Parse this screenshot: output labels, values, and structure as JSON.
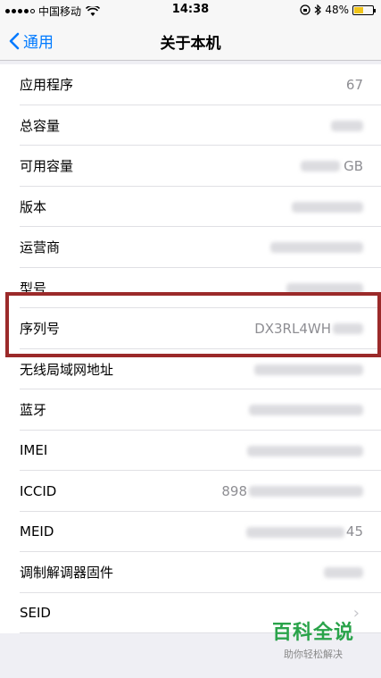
{
  "status_bar": {
    "carrier": "中国移动",
    "time": "14:38",
    "battery_percent": "48%",
    "battery_level": 0.48
  },
  "nav": {
    "back_label": "通用",
    "title": "关于本机"
  },
  "rows": [
    {
      "label": "应用程序",
      "value": "67"
    },
    {
      "label": "总容量",
      "value": ""
    },
    {
      "label": "可用容量",
      "value": "GB"
    },
    {
      "label": "版本",
      "value": ""
    },
    {
      "label": "运营商",
      "value": ""
    },
    {
      "label": "型号",
      "value": ""
    },
    {
      "label": "序列号",
      "value": "DX3RL4WH"
    },
    {
      "label": "无线局域网地址",
      "value": ""
    },
    {
      "label": "蓝牙",
      "value": ""
    },
    {
      "label": "IMEI",
      "value": ""
    },
    {
      "label": "ICCID",
      "value": "898"
    },
    {
      "label": "MEID",
      "value": "45"
    },
    {
      "label": "调制解调器固件",
      "value": ""
    },
    {
      "label": "SEID",
      "value": ""
    }
  ],
  "watermark": {
    "title": "百科全说",
    "subtitle": "助你轻松解决"
  },
  "colors": {
    "accent": "#007aff",
    "highlight": "#9b2a2a",
    "watermark": "#2aa34a"
  }
}
